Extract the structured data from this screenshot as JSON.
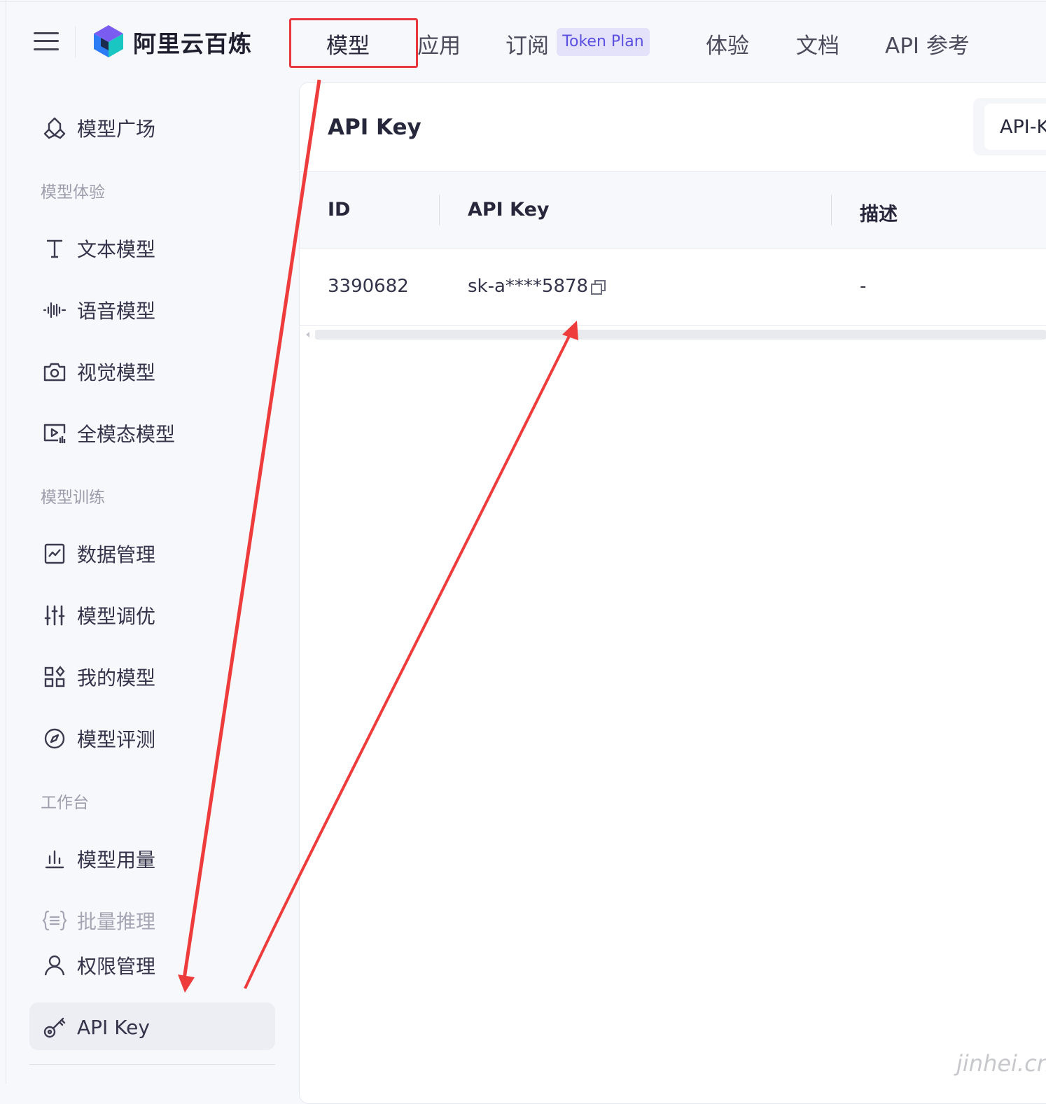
{
  "header": {
    "brand": "阿里云百炼",
    "nav": [
      "模型",
      "应用",
      "订阅",
      "体验",
      "文档",
      "API 参考"
    ],
    "badge": "Token Plan"
  },
  "sidebar": {
    "top_item": "模型广场",
    "group_experience": "模型体验",
    "experience_items": [
      "文本模型",
      "语音模型",
      "视觉模型",
      "全模态模型"
    ],
    "group_training": "模型训练",
    "training_items": [
      "数据管理",
      "模型调优",
      "我的模型",
      "模型评测"
    ],
    "group_workspace": "工作台",
    "workspace_items": [
      "模型用量",
      "批量推理",
      "权限管理",
      "API Key"
    ]
  },
  "main": {
    "title": "API Key",
    "tab_label": "API-K",
    "columns": [
      "ID",
      "API Key",
      "描述"
    ],
    "rows": [
      {
        "id": "3390682",
        "key": "sk-a****5878",
        "desc": "-"
      }
    ]
  },
  "watermark": "jinhei.cn",
  "colors": {
    "accent": "#5b4fe0",
    "annotation_red": "#e8383d",
    "active_bg": "#eceef4"
  }
}
